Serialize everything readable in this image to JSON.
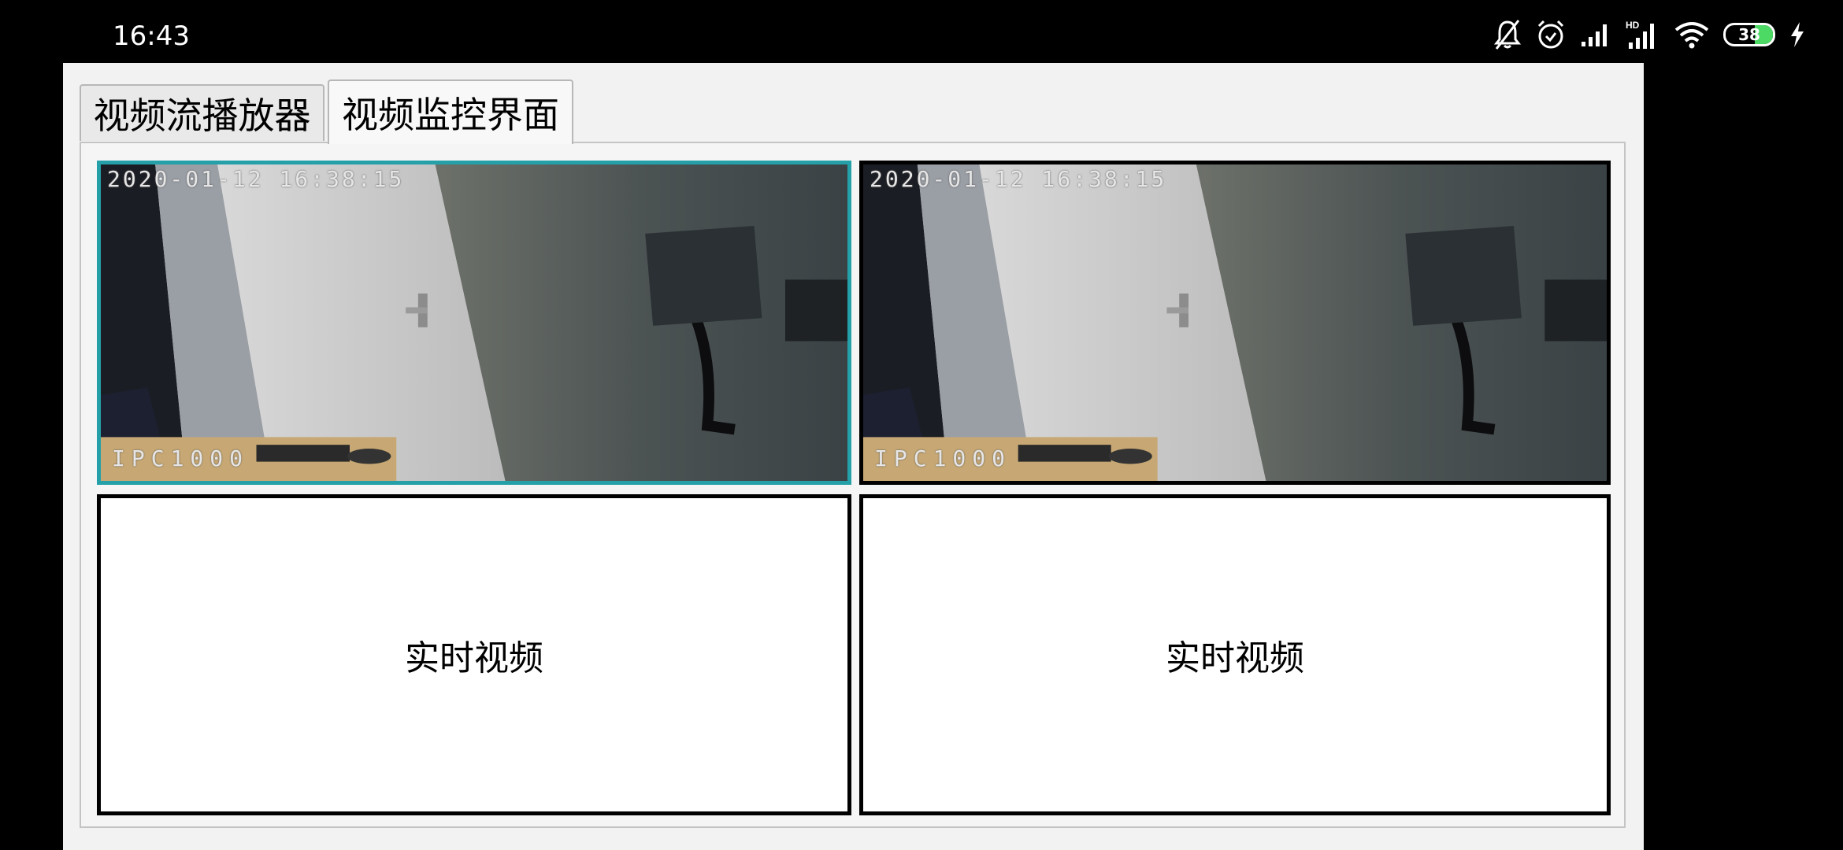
{
  "status_bar": {
    "time": "16:43",
    "icons": [
      "mute-icon",
      "alarm-icon",
      "signal-icon",
      "hd-signal-icon",
      "wifi-icon",
      "battery-icon",
      "charging-icon"
    ],
    "hd_label": "HD",
    "battery_level": "38"
  },
  "tabs": [
    {
      "label": "视频流播放器",
      "selected": false
    },
    {
      "label": "视频监控界面",
      "selected": true
    }
  ],
  "cells": [
    {
      "timestamp": "2020-01-12 16:38:15",
      "channel": "IPC1000",
      "selected": true
    },
    {
      "timestamp": "2020-01-12 16:38:15",
      "channel": "IPC1000",
      "selected": false
    },
    {
      "label": "实时视频"
    },
    {
      "label": "实时视频"
    }
  ],
  "colors": {
    "selection_border": "#26a0a8",
    "cell_border": "#000000",
    "battery_fill": "#4cd964"
  }
}
